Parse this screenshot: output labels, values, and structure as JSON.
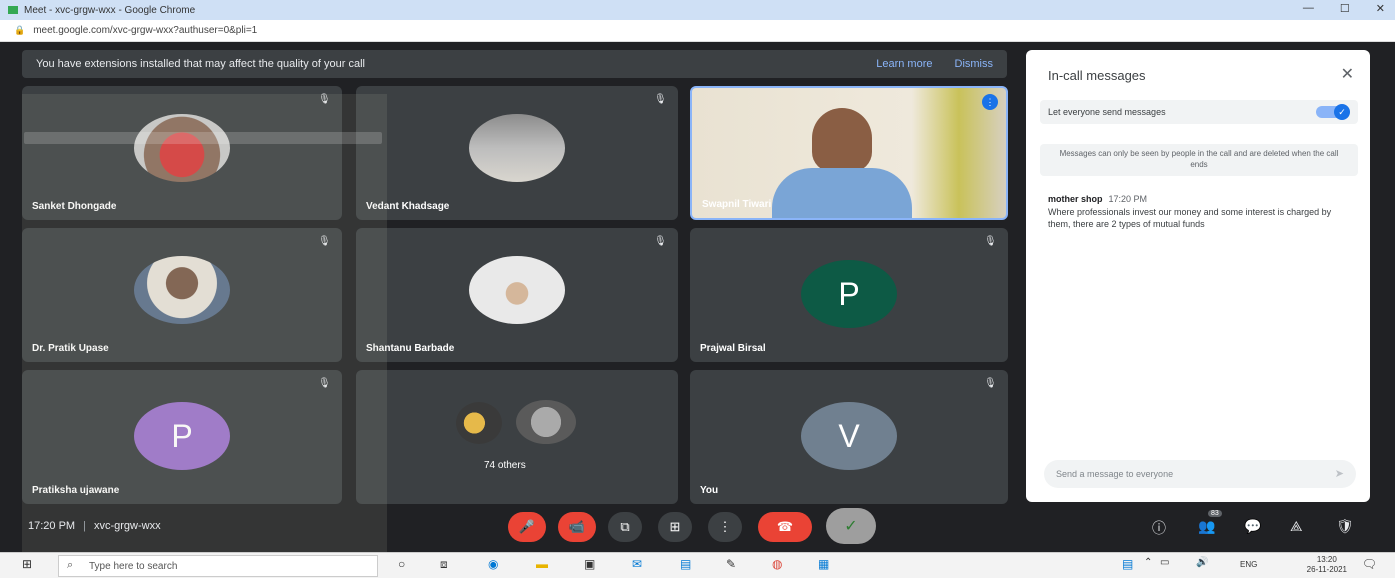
{
  "browser": {
    "title": "Meet - xvc-grgw-wxx - Google Chrome",
    "url": "meet.google.com/xvc-grgw-wxx?authuser=0&pli=1",
    "win_min": "—",
    "win_max": "☐",
    "win_close": "✕"
  },
  "banner": {
    "text": "You have extensions installed that may affect the quality of your call",
    "learn_more": "Learn more",
    "dismiss": "Dismiss"
  },
  "tiles": [
    {
      "name": "Sanket Dhongade"
    },
    {
      "name": "Vedant Khadsage"
    },
    {
      "name": "Swapnil Tiwari"
    },
    {
      "name": "Dr. Pratik Upase"
    },
    {
      "name": "Shantanu Barbade"
    },
    {
      "name": "Prajwal Birsal",
      "letter": "P"
    },
    {
      "name": "Pratiksha ujawane",
      "letter": "P"
    },
    {
      "name": "74 others"
    },
    {
      "name": "You",
      "letter": "V"
    }
  ],
  "chat": {
    "title": "In-call messages",
    "toggle_label": "Let everyone send messages",
    "note": "Messages can only be seen by people in the call and are deleted when the call ends",
    "messages": [
      {
        "sender": "mother shop",
        "time": "17:20 PM",
        "text": "Where professionals invest our money and some interest is charged by them, there are 2 types of mutual funds"
      }
    ],
    "input_placeholder": "Send a message to everyone"
  },
  "meeting": {
    "time": "17:20 PM",
    "separator": "|",
    "code": "xvc-grgw-wxx"
  },
  "right_controls": {
    "participant_count": "83"
  },
  "taskbar": {
    "search_placeholder": "Type here to search",
    "lang": "ENG",
    "time": "13:20",
    "date": "26-11-2021"
  },
  "colors": {
    "meet_bg": "#202124",
    "tile_bg": "#3c4043",
    "end_call": "#ea4335",
    "avatar_p_green": "#0d5a45",
    "avatar_p_purple": "#9b72cb",
    "avatar_v": "#708090",
    "accent_blue": "#1a73e8"
  }
}
